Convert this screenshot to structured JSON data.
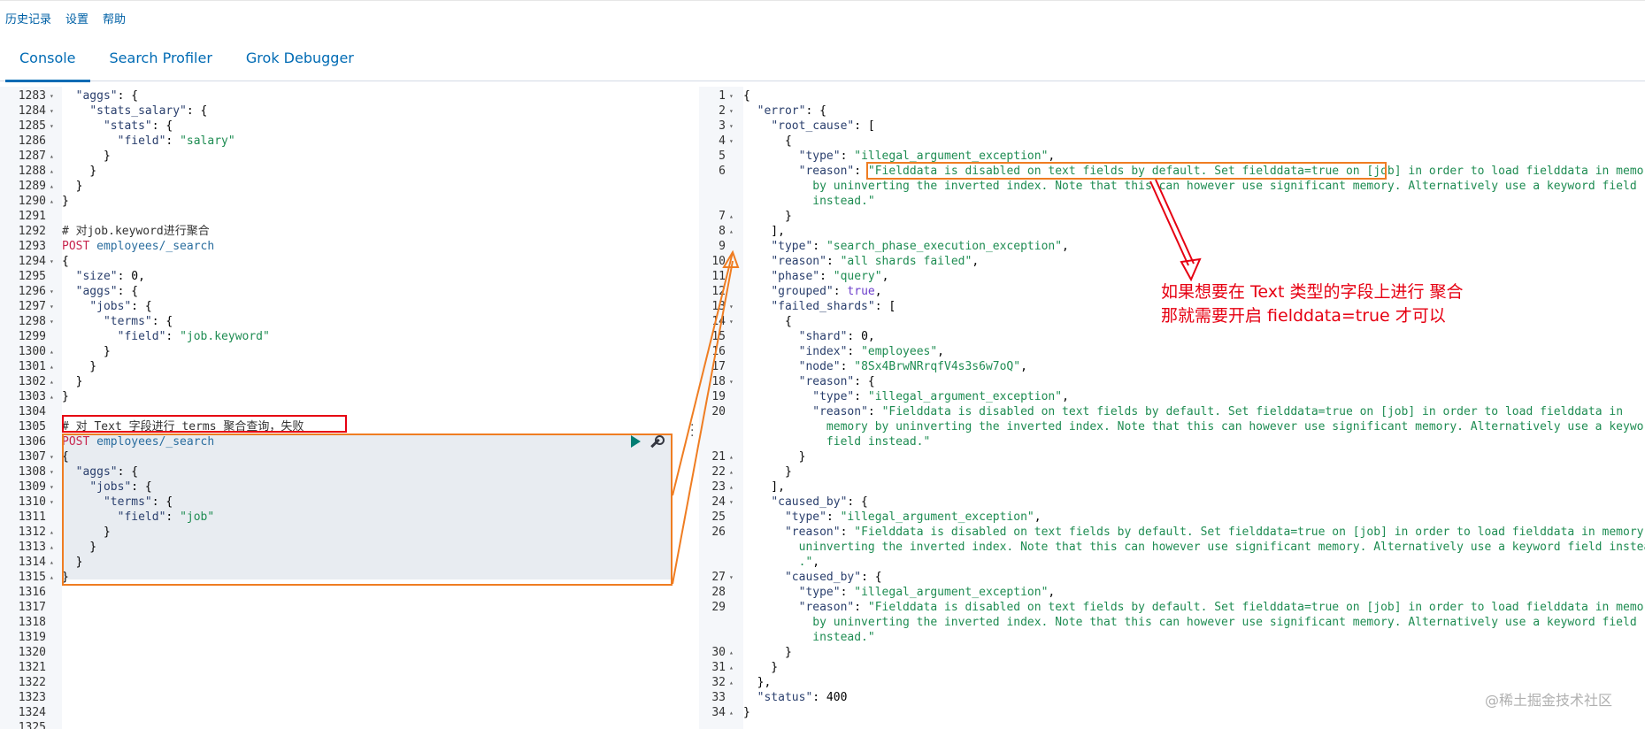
{
  "topmenu": {
    "history": "历史记录",
    "settings": "设置",
    "help": "帮助"
  },
  "tabs": [
    "Console",
    "Search Profiler",
    "Grok Debugger"
  ],
  "left_lines": [
    {
      "n": "1283",
      "f": "▾",
      "h": "  <span class=\"k\">\"aggs\"</span>: {"
    },
    {
      "n": "1284",
      "f": "▾",
      "h": "    <span class=\"k\">\"stats_salary\"</span>: {"
    },
    {
      "n": "1285",
      "f": "▾",
      "h": "      <span class=\"k\">\"stats\"</span>: {"
    },
    {
      "n": "1286",
      "f": "",
      "h": "        <span class=\"k\">\"field\"</span>: <span class=\"s\">\"salary\"</span>"
    },
    {
      "n": "1287",
      "f": "▴",
      "h": "      }"
    },
    {
      "n": "1288",
      "f": "▴",
      "h": "    }"
    },
    {
      "n": "1289",
      "f": "▴",
      "h": "  }"
    },
    {
      "n": "1290",
      "f": "▴",
      "h": "}"
    },
    {
      "n": "1291",
      "f": "",
      "h": ""
    },
    {
      "n": "1292",
      "f": "",
      "h": "<span class=\"cm\"># 对job.keyword进行聚合</span>"
    },
    {
      "n": "1293",
      "f": "",
      "h": "<span class=\"method\">POST</span> <span class=\"url\">employees/_search</span>"
    },
    {
      "n": "1294",
      "f": "▾",
      "h": "{"
    },
    {
      "n": "1295",
      "f": "",
      "h": "  <span class=\"k\">\"size\"</span>: 0,"
    },
    {
      "n": "1296",
      "f": "▾",
      "h": "  <span class=\"k\">\"aggs\"</span>: {"
    },
    {
      "n": "1297",
      "f": "▾",
      "h": "    <span class=\"k\">\"jobs\"</span>: {"
    },
    {
      "n": "1298",
      "f": "▾",
      "h": "      <span class=\"k\">\"terms\"</span>: {"
    },
    {
      "n": "1299",
      "f": "",
      "h": "        <span class=\"k\">\"field\"</span>: <span class=\"s\">\"job.keyword\"</span>"
    },
    {
      "n": "1300",
      "f": "▴",
      "h": "      }"
    },
    {
      "n": "1301",
      "f": "▴",
      "h": "    }"
    },
    {
      "n": "1302",
      "f": "▴",
      "h": "  }"
    },
    {
      "n": "1303",
      "f": "▴",
      "h": "}"
    },
    {
      "n": "1304",
      "f": "",
      "h": ""
    },
    {
      "n": "1305",
      "f": "",
      "h": "<span class=\"cm\"># 对 Text 字段进行 terms 聚合查询，失败</span>"
    },
    {
      "n": "1306",
      "f": "",
      "h": "<span class=\"method\">POST</span> <span class=\"url\">employees/_search</span>"
    },
    {
      "n": "1307",
      "f": "▾",
      "h": "{"
    },
    {
      "n": "1308",
      "f": "▾",
      "h": "  <span class=\"k\">\"aggs\"</span>: {"
    },
    {
      "n": "1309",
      "f": "▾",
      "h": "    <span class=\"k\">\"jobs\"</span>: {"
    },
    {
      "n": "1310",
      "f": "▾",
      "h": "      <span class=\"k\">\"terms\"</span>: {"
    },
    {
      "n": "1311",
      "f": "",
      "h": "        <span class=\"k\">\"field\"</span>: <span class=\"s\">\"job\"</span>"
    },
    {
      "n": "1312",
      "f": "▴",
      "h": "      }"
    },
    {
      "n": "1313",
      "f": "▴",
      "h": "    }"
    },
    {
      "n": "1314",
      "f": "▴",
      "h": "  }"
    },
    {
      "n": "1315",
      "f": "▴",
      "h": "}"
    },
    {
      "n": "1316",
      "f": "",
      "h": ""
    },
    {
      "n": "1317",
      "f": "",
      "h": ""
    },
    {
      "n": "1318",
      "f": "",
      "h": ""
    },
    {
      "n": "1319",
      "f": "",
      "h": ""
    },
    {
      "n": "1320",
      "f": "",
      "h": ""
    },
    {
      "n": "1321",
      "f": "",
      "h": ""
    },
    {
      "n": "1322",
      "f": "",
      "h": ""
    },
    {
      "n": "1323",
      "f": "",
      "h": ""
    },
    {
      "n": "1324",
      "f": "",
      "h": ""
    },
    {
      "n": "1325",
      "f": "",
      "h": ""
    }
  ],
  "right_lines": [
    {
      "n": "1",
      "f": "▾",
      "h": "{"
    },
    {
      "n": "2",
      "f": "▾",
      "h": "  <span class=\"k\">\"error\"</span>: {"
    },
    {
      "n": "3",
      "f": "▾",
      "h": "    <span class=\"k\">\"root_cause\"</span>: ["
    },
    {
      "n": "4",
      "f": "▾",
      "h": "      {"
    },
    {
      "n": "5",
      "f": "",
      "h": "        <span class=\"k\">\"type\"</span>: <span class=\"s\">\"illegal_argument_exception\"</span>,"
    },
    {
      "n": "6",
      "f": "",
      "h": "        <span class=\"k\">\"reason\"</span>: <span class=\"s\">\"Fielddata is disabled on text fields by default. Set fielddata=true on [job] in order to load fielddata in memory</span>"
    },
    {
      "n": "",
      "f": "",
      "h": "<span class=\"s\">          by uninverting the inverted index. Note that this can however use significant memory. Alternatively use a keyword field</span>"
    },
    {
      "n": "",
      "f": "",
      "h": "<span class=\"s\">          instead.\"</span>"
    },
    {
      "n": "7",
      "f": "▴",
      "h": "      }"
    },
    {
      "n": "8",
      "f": "▴",
      "h": "    ],"
    },
    {
      "n": "9",
      "f": "",
      "h": "    <span class=\"k\">\"type\"</span>: <span class=\"s\">\"search_phase_execution_exception\"</span>,"
    },
    {
      "n": "10",
      "f": "",
      "h": "    <span class=\"k\">\"reason\"</span>: <span class=\"s\">\"all shards failed\"</span>,"
    },
    {
      "n": "11",
      "f": "",
      "h": "    <span class=\"k\">\"phase\"</span>: <span class=\"s\">\"query\"</span>,"
    },
    {
      "n": "12",
      "f": "",
      "h": "    <span class=\"k\">\"grouped\"</span>: <span class=\"bool\">true</span>,"
    },
    {
      "n": "13",
      "f": "▾",
      "h": "    <span class=\"k\">\"failed_shards\"</span>: ["
    },
    {
      "n": "14",
      "f": "▾",
      "h": "      {"
    },
    {
      "n": "15",
      "f": "",
      "h": "        <span class=\"k\">\"shard\"</span>: 0,"
    },
    {
      "n": "16",
      "f": "",
      "h": "        <span class=\"k\">\"index\"</span>: <span class=\"s\">\"employees\"</span>,"
    },
    {
      "n": "17",
      "f": "",
      "h": "        <span class=\"k\">\"node\"</span>: <span class=\"s\">\"8Sx4BrwNRrqfV4s3s6w7oQ\"</span>,"
    },
    {
      "n": "18",
      "f": "▾",
      "h": "        <span class=\"k\">\"reason\"</span>: {"
    },
    {
      "n": "19",
      "f": "",
      "h": "          <span class=\"k\">\"type\"</span>: <span class=\"s\">\"illegal_argument_exception\"</span>,"
    },
    {
      "n": "20",
      "f": "",
      "h": "          <span class=\"k\">\"reason\"</span>: <span class=\"s\">\"Fielddata is disabled on text fields by default. Set fielddata=true on [job] in order to load fielddata in</span>"
    },
    {
      "n": "",
      "f": "",
      "h": "<span class=\"s\">            memory by uninverting the inverted index. Note that this can however use significant memory. Alternatively use a keyword</span>"
    },
    {
      "n": "",
      "f": "",
      "h": "<span class=\"s\">            field instead.\"</span>"
    },
    {
      "n": "21",
      "f": "▴",
      "h": "        }"
    },
    {
      "n": "22",
      "f": "▴",
      "h": "      }"
    },
    {
      "n": "23",
      "f": "▴",
      "h": "    ],"
    },
    {
      "n": "24",
      "f": "▾",
      "h": "    <span class=\"k\">\"caused_by\"</span>: {"
    },
    {
      "n": "25",
      "f": "",
      "h": "      <span class=\"k\">\"type\"</span>: <span class=\"s\">\"illegal_argument_exception\"</span>,"
    },
    {
      "n": "26",
      "f": "",
      "h": "      <span class=\"k\">\"reason\"</span>: <span class=\"s\">\"Fielddata is disabled on text fields by default. Set fielddata=true on [job] in order to load fielddata in memory by</span>"
    },
    {
      "n": "",
      "f": "",
      "h": "<span class=\"s\">        uninverting the inverted index. Note that this can however use significant memory. Alternatively use a keyword field instead</span>"
    },
    {
      "n": "",
      "f": "",
      "h": "<span class=\"s\">        .\"</span>,"
    },
    {
      "n": "27",
      "f": "▾",
      "h": "      <span class=\"k\">\"caused_by\"</span>: {"
    },
    {
      "n": "28",
      "f": "",
      "h": "        <span class=\"k\">\"type\"</span>: <span class=\"s\">\"illegal_argument_exception\"</span>,"
    },
    {
      "n": "29",
      "f": "",
      "h": "        <span class=\"k\">\"reason\"</span>: <span class=\"s\">\"Fielddata is disabled on text fields by default. Set fielddata=true on [job] in order to load fielddata in memory</span>"
    },
    {
      "n": "",
      "f": "",
      "h": "<span class=\"s\">          by uninverting the inverted index. Note that this can however use significant memory. Alternatively use a keyword field</span>"
    },
    {
      "n": "",
      "f": "",
      "h": "<span class=\"s\">          instead.\"</span>"
    },
    {
      "n": "30",
      "f": "▴",
      "h": "      }"
    },
    {
      "n": "31",
      "f": "▴",
      "h": "    }"
    },
    {
      "n": "32",
      "f": "▴",
      "h": "  },"
    },
    {
      "n": "33",
      "f": "",
      "h": "  <span class=\"k\">\"status\"</span>: 400"
    },
    {
      "n": "34",
      "f": "▴",
      "h": "}"
    }
  ],
  "annotation": {
    "line1": "如果想要在 Text 类型的字段上进行 聚合",
    "line2": "那就需要开启 fielddata=true 才可以"
  },
  "watermark": "@稀土掘金技术社区",
  "colors": {
    "accent": "#006bb4",
    "annotation_red": "#e60012",
    "annotation_orange": "#ef7d22"
  }
}
